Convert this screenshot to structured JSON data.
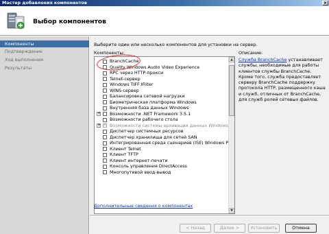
{
  "window": {
    "title": "Мастер добавления компонентов",
    "close_glyph": "×"
  },
  "header": {
    "title": "Выбор компонентов",
    "icon": "server-add-components-icon"
  },
  "sidebar": {
    "items": [
      {
        "label": "Компоненты",
        "active": true
      },
      {
        "label": "Подтверждение",
        "active": false
      },
      {
        "label": "Ход выполнения",
        "active": false
      },
      {
        "label": "Результаты",
        "active": false
      }
    ]
  },
  "main": {
    "instruction": "Выберите один или несколько компонентов для установки на сервер.",
    "components_label": "Компоненты:",
    "description_label": "Описание:",
    "components": [
      {
        "label": "BranchCache",
        "expandable": false,
        "checked": false,
        "disabled": false
      },
      {
        "label": "Quality Windows Audio Video Experience",
        "expandable": false,
        "checked": false,
        "disabled": false
      },
      {
        "label": "RPC через HTTP-прокси",
        "expandable": false,
        "checked": false,
        "disabled": false
      },
      {
        "label": "Telnet-сервер",
        "expandable": false,
        "checked": false,
        "disabled": false
      },
      {
        "label": "Windows TIFF IFilter",
        "expandable": false,
        "checked": false,
        "disabled": false
      },
      {
        "label": "WINS-сервер",
        "expandable": false,
        "checked": false,
        "disabled": false
      },
      {
        "label": "Балансировка сетевой нагрузки",
        "expandable": false,
        "checked": false,
        "disabled": false
      },
      {
        "label": "Биометрическая платформа Windows",
        "expandable": false,
        "checked": false,
        "disabled": false
      },
      {
        "label": "Внутренняя база данных Windows",
        "expandable": false,
        "checked": false,
        "disabled": false
      },
      {
        "label": "Возможности .NET Framework 3.5.1",
        "expandable": true,
        "checked": false,
        "disabled": false
      },
      {
        "label": "Возможности рабочего стола",
        "expandable": false,
        "checked": false,
        "disabled": false
      },
      {
        "label": "Возможности системы архивации данных Windows Ser",
        "expandable": true,
        "checked": true,
        "disabled": true
      },
      {
        "label": "Диспетчер системных ресурсов",
        "expandable": false,
        "checked": false,
        "disabled": false
      },
      {
        "label": "Диспетчер хранилища для сетей SAN",
        "expandable": false,
        "checked": false,
        "disabled": false
      },
      {
        "label": "Интегрированная среда сценариев (ISE) Windows Pow",
        "expandable": false,
        "checked": false,
        "disabled": false
      },
      {
        "label": "Клиент Telnet",
        "expandable": false,
        "checked": false,
        "disabled": false
      },
      {
        "label": "Клиент TFTP",
        "expandable": false,
        "checked": false,
        "disabled": false
      },
      {
        "label": "Клиент интернет-печати",
        "expandable": false,
        "checked": false,
        "disabled": false
      },
      {
        "label": "Консоль управления DirectAccess",
        "expandable": false,
        "checked": false,
        "disabled": false
      },
      {
        "label": "Многопутевой ввод-вывод",
        "expandable": false,
        "checked": false,
        "disabled": false
      }
    ],
    "description": {
      "link_text": "Служба BranchCache",
      "text_1": "устанавливает службы, необходимые для работы клиентов службы BranchCache. Кроме того, служба предоставляет серверу BranchCache поддержку протокола HTTP, размещенного кэша и служб, отличных от BranchCache, для служб ролей сетевых файлов."
    },
    "more_info_link": "Дополнительные сведения о компонентах"
  },
  "footer": {
    "back": "< Назад",
    "next": "Далее >",
    "install": "Установить",
    "cancel": "Отмена"
  },
  "colors": {
    "annotation": "#e5261e",
    "selected_nav": "#3a6ea5",
    "link": "#0033cc"
  }
}
